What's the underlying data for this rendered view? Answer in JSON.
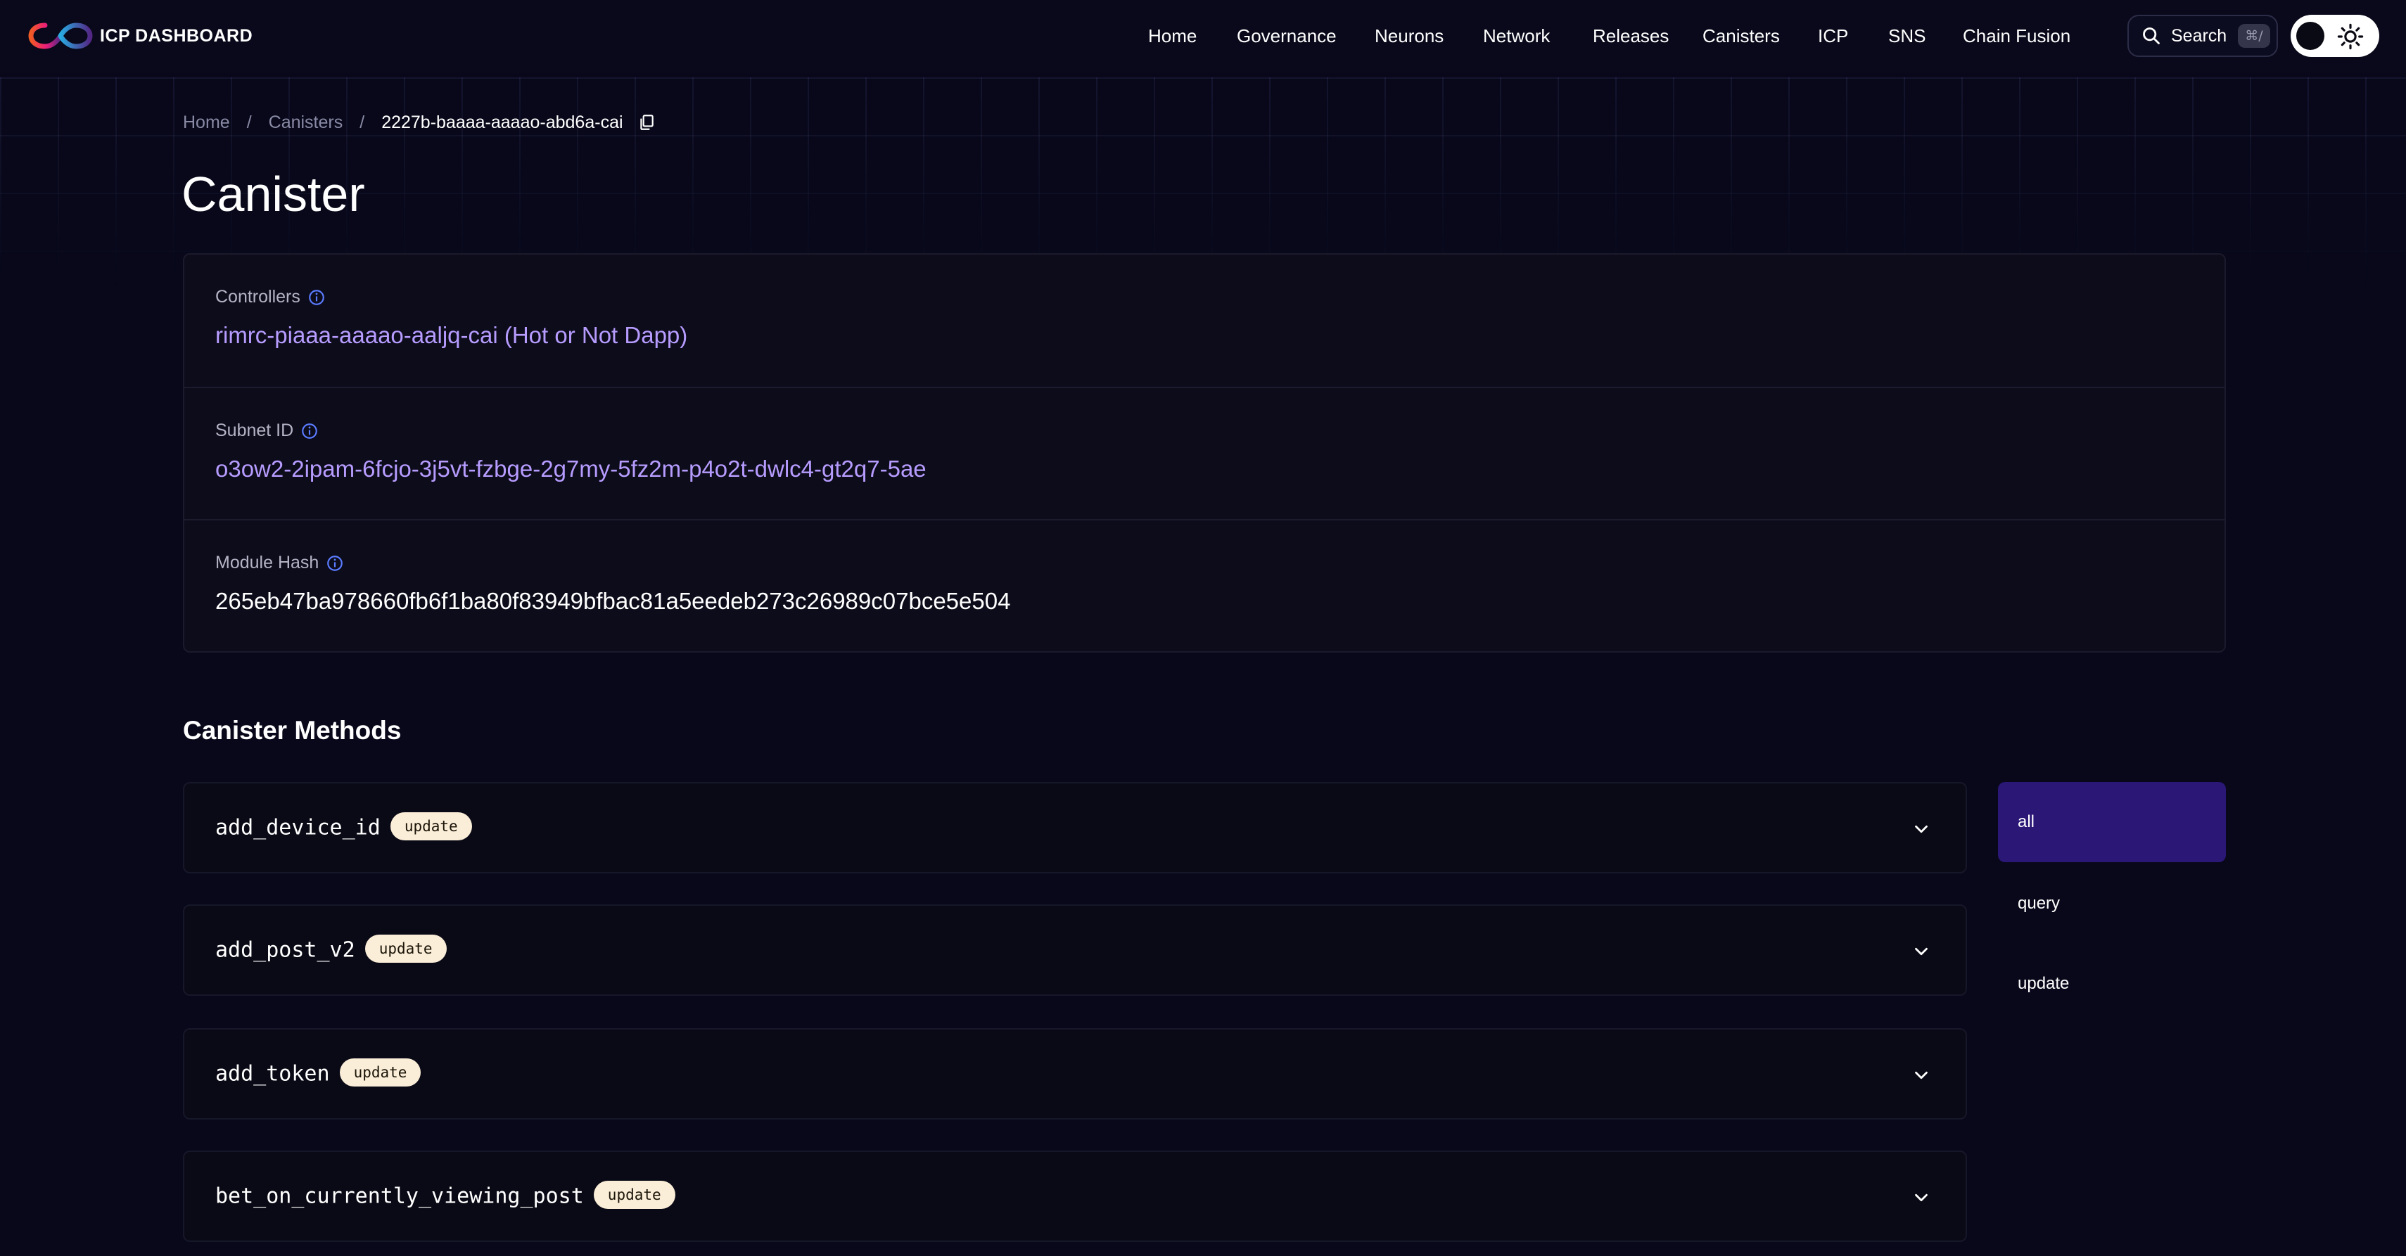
{
  "header": {
    "brand_name": "ICP DASHBOARD",
    "nav": [
      "Home",
      "Governance",
      "Neurons",
      "Network",
      "Releases",
      "Canisters",
      "ICP",
      "SNS",
      "Chain Fusion"
    ],
    "search_label": "Search",
    "search_shortcut": "⌘/"
  },
  "breadcrumb": {
    "home": "Home",
    "separator": "/",
    "canisters": "Canisters",
    "current": "2227b-baaaa-aaaao-abd6a-cai"
  },
  "page_title": "Canister",
  "info": {
    "controllers_label": "Controllers",
    "controllers_value": "rimrc-piaaa-aaaao-aaljq-cai (Hot or Not Dapp)",
    "subnet_label": "Subnet ID",
    "subnet_value": "o3ow2-2ipam-6fcjo-3j5vt-fzbge-2g7my-5fz2m-p4o2t-dwlc4-gt2q7-5ae",
    "module_hash_label": "Module Hash",
    "module_hash_value": "265eb47ba978660fb6f1ba80f83949bfbac81a5eedeb273c26989c07bce5e504"
  },
  "methods_title": "Canister Methods",
  "methods": [
    {
      "name": "add_device_id",
      "type": "update"
    },
    {
      "name": "add_post_v2",
      "type": "update"
    },
    {
      "name": "add_token",
      "type": "update"
    },
    {
      "name": "bet_on_currently_viewing_post",
      "type": "update"
    }
  ],
  "filters": [
    {
      "label": "all",
      "active": true
    },
    {
      "label": "query",
      "active": false
    },
    {
      "label": "update",
      "active": false
    }
  ],
  "colors": {
    "background": "#08081a",
    "link": "#b79cff",
    "accent_active": "#2a1776",
    "badge": "#fbeed8"
  }
}
